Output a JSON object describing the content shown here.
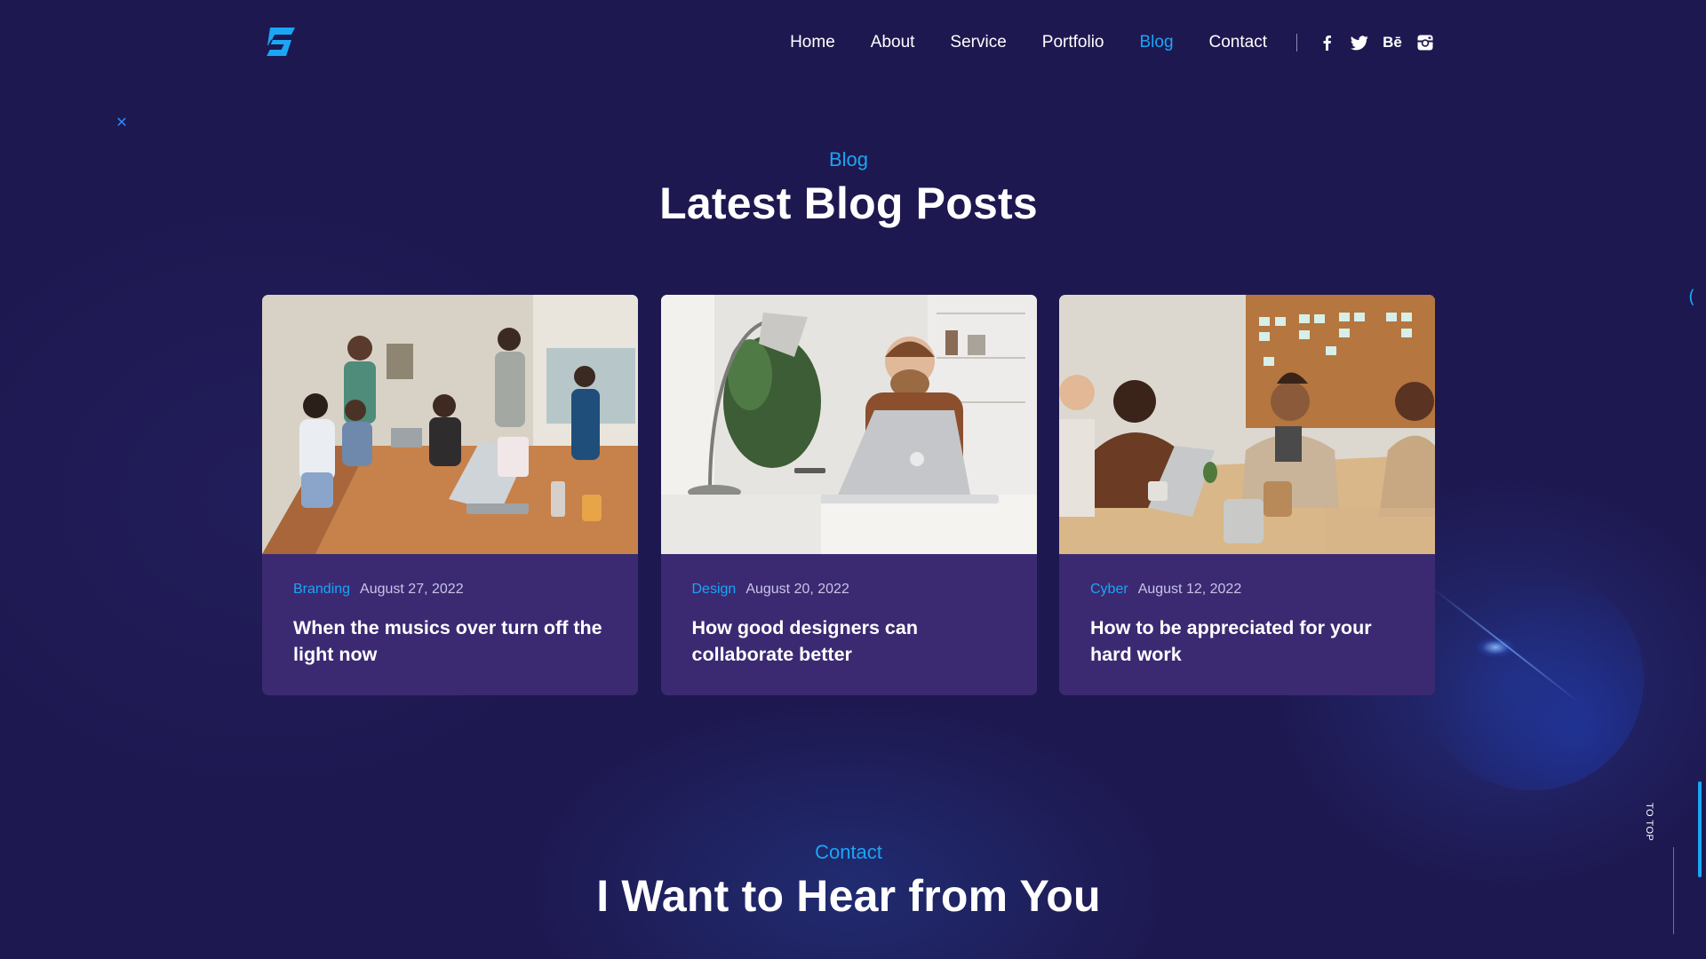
{
  "nav": {
    "items": [
      {
        "label": "Home",
        "active": false
      },
      {
        "label": "About",
        "active": false
      },
      {
        "label": "Service",
        "active": false
      },
      {
        "label": "Portfolio",
        "active": false
      },
      {
        "label": "Blog",
        "active": true
      },
      {
        "label": "Contact",
        "active": false
      }
    ],
    "social": [
      {
        "icon": "facebook-icon",
        "glyph": "f"
      },
      {
        "icon": "twitter-icon",
        "glyph": ""
      },
      {
        "icon": "behance-icon",
        "glyph": "Bē"
      },
      {
        "icon": "instagram-icon",
        "glyph": ""
      }
    ]
  },
  "blog": {
    "eyebrow": "Blog",
    "title": "Latest Blog Posts",
    "posts": [
      {
        "category": "Branding",
        "date": "August 27, 2022",
        "title": "When the musics over turn off the light now",
        "image": "team-meeting-photo"
      },
      {
        "category": "Design",
        "date": "August 20, 2022",
        "title": "How good designers can collaborate better",
        "image": "designer-laptop-photo"
      },
      {
        "category": "Cyber",
        "date": "August 12, 2022",
        "title": "How to be appreciated for your hard work",
        "image": "office-discussion-photo"
      }
    ]
  },
  "contact": {
    "eyebrow": "Contact",
    "title": "I Want to Hear from You"
  },
  "to_top": {
    "label": "TO TOP"
  },
  "colors": {
    "background": "#1e1850",
    "accent": "#1aa6f5",
    "card": "#3b2a72"
  }
}
